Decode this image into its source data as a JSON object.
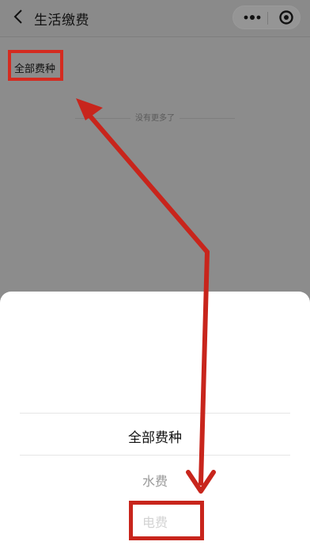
{
  "header": {
    "title": "生活缴费"
  },
  "filter": {
    "label": "全部费种"
  },
  "list": {
    "empty_text": "没有更多了"
  },
  "picker": {
    "options": [
      "全部费种",
      "水费",
      "电费"
    ],
    "selected": "全部费种"
  },
  "colors": {
    "annotation": "#d42b20",
    "overlay": "#8c8c8c",
    "sheet": "#ffffff"
  },
  "icons": [
    "back-icon",
    "more-icon",
    "target-icon"
  ]
}
